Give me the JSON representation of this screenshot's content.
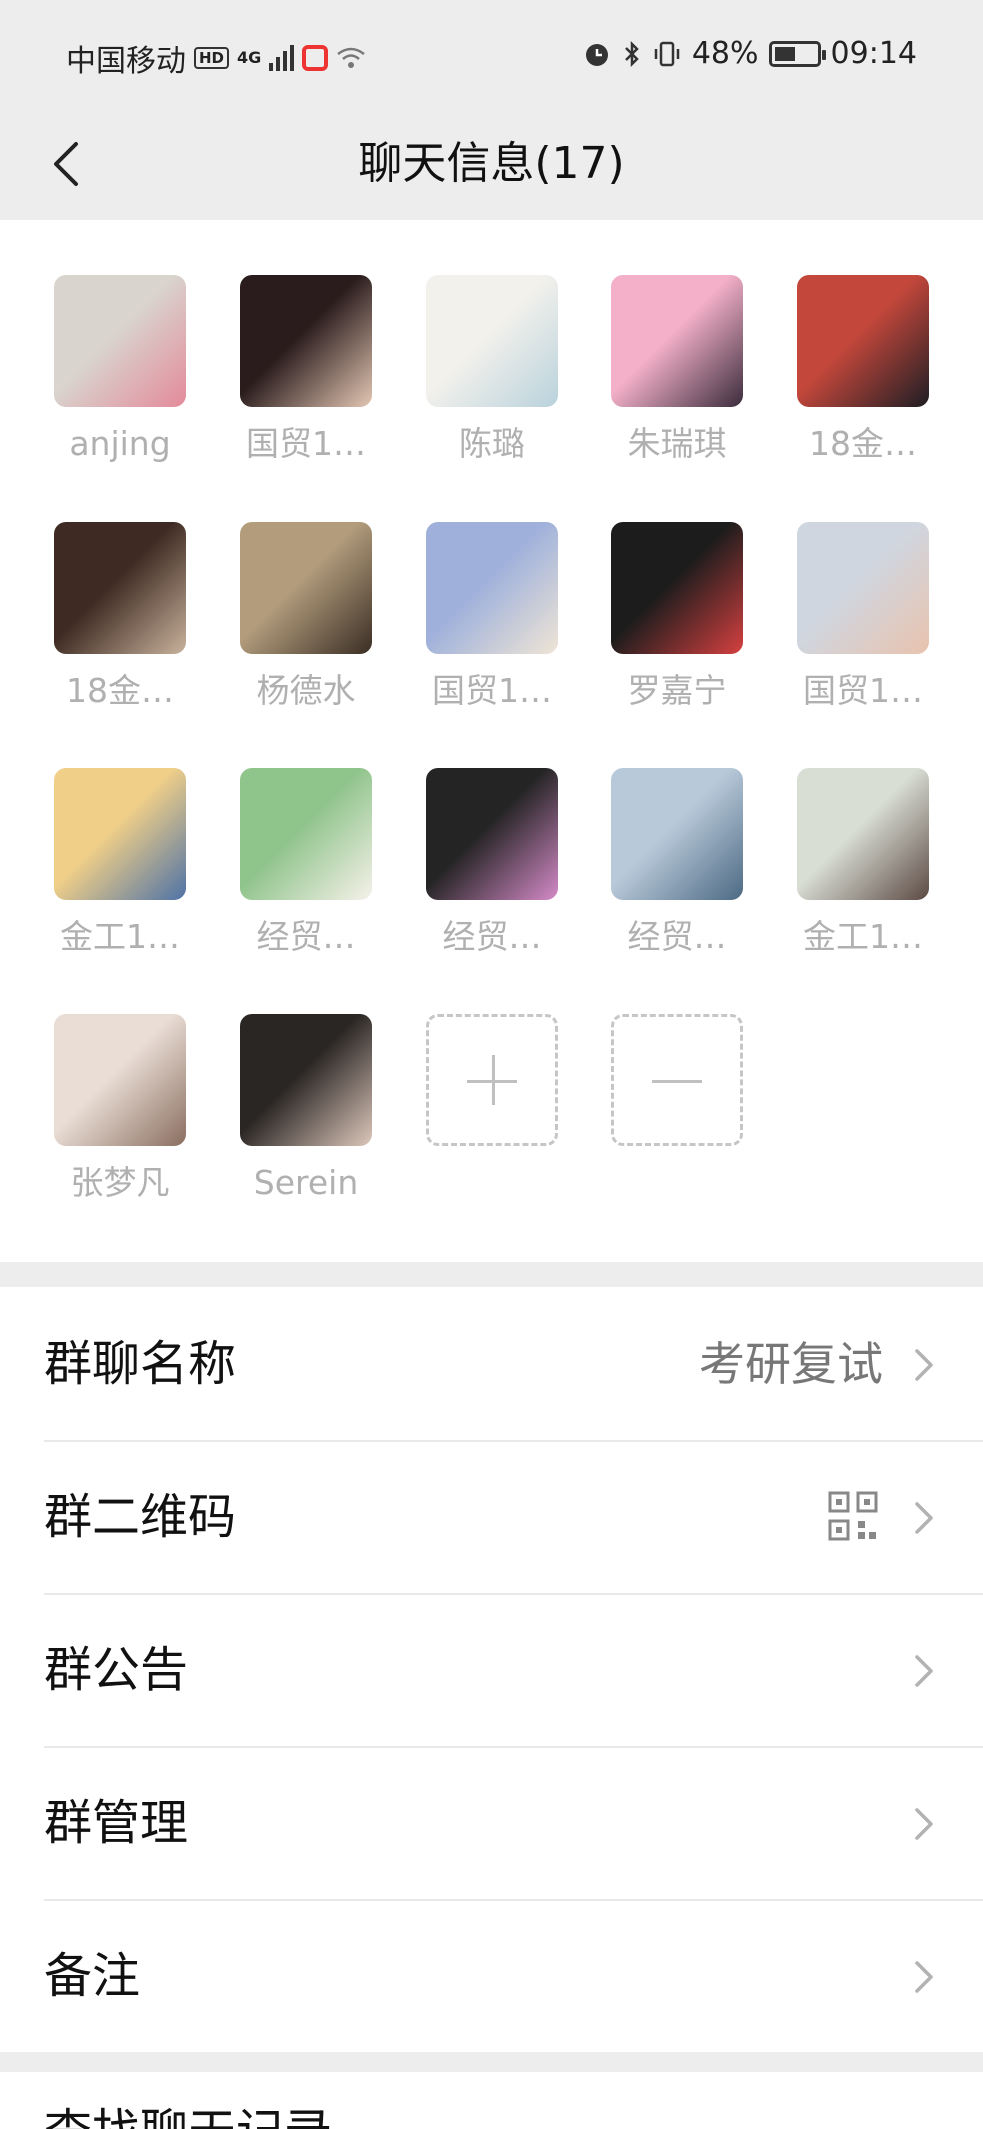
{
  "status_bar": {
    "carrier": "中国移动",
    "hd": "HD",
    "network": "4G",
    "battery_percent": "48%",
    "time": "09:14"
  },
  "header": {
    "back_icon": "chevron-left-icon",
    "title": "聊天信息(17)"
  },
  "members": [
    {
      "name": "anjing",
      "colors": [
        "#d9d4ce",
        "#e38a9a"
      ]
    },
    {
      "name": "国贸1…",
      "colors": [
        "#2a1c1c",
        "#e4c7b4"
      ]
    },
    {
      "name": "陈璐",
      "colors": [
        "#f3f1ec",
        "#b9d2dc"
      ]
    },
    {
      "name": "朱瑞琪",
      "colors": [
        "#f3b0c8",
        "#3b2c3c"
      ]
    },
    {
      "name": "18金…",
      "colors": [
        "#c4473b",
        "#1e1e24"
      ]
    },
    {
      "name": "18金…",
      "colors": [
        "#3e2a22",
        "#c9b29c"
      ]
    },
    {
      "name": "杨德水",
      "colors": [
        "#b29c7c",
        "#3a2e24"
      ]
    },
    {
      "name": "国贸1…",
      "colors": [
        "#9fb1db",
        "#efe5d6"
      ]
    },
    {
      "name": "罗嘉宁",
      "colors": [
        "#1c1c1c",
        "#d64040"
      ]
    },
    {
      "name": "国贸1…",
      "colors": [
        "#d0d6e0",
        "#e9c3ae"
      ]
    },
    {
      "name": "金工1…",
      "colors": [
        "#f0cf88",
        "#4e72a6"
      ]
    },
    {
      "name": "经贸…",
      "colors": [
        "#8fc48b",
        "#f6f1ea"
      ]
    },
    {
      "name": "经贸…",
      "colors": [
        "#242424",
        "#d58ac8"
      ]
    },
    {
      "name": "经贸…",
      "colors": [
        "#b8c9d9",
        "#4d6a84"
      ]
    },
    {
      "name": "金工1…",
      "colors": [
        "#d9ded5",
        "#5c4a44"
      ]
    },
    {
      "name": "张梦凡",
      "colors": [
        "#e9ddd5",
        "#8a6e60"
      ]
    },
    {
      "name": "Serein",
      "colors": [
        "#2a2624",
        "#ddc8bc"
      ]
    }
  ],
  "member_actions": {
    "add_icon": "plus-icon",
    "remove_icon": "minus-icon"
  },
  "settings": {
    "group_name": {
      "label": "群聊名称",
      "value": "考研复试"
    },
    "group_qr": {
      "label": "群二维码",
      "icon": "qr-code-icon"
    },
    "announcement": {
      "label": "群公告"
    },
    "management": {
      "label": "群管理"
    },
    "remark": {
      "label": "备注"
    },
    "partial_next": {
      "label": "查找聊天记录"
    }
  }
}
